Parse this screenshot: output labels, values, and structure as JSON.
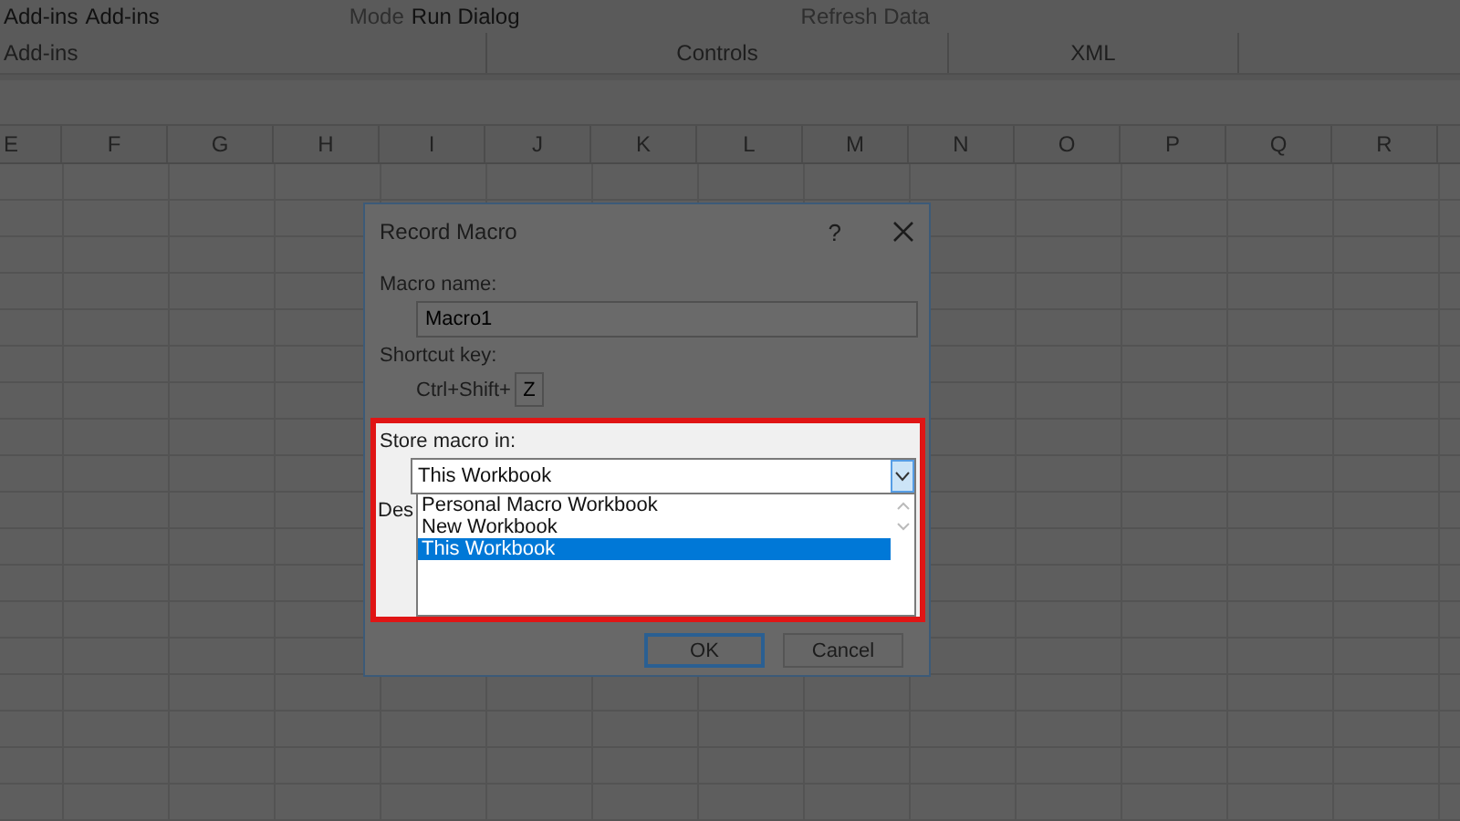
{
  "ribbon": {
    "top_items": [
      "Add-ins",
      "Add-ins",
      "Mode",
      "Run Dialog",
      "Refresh Data"
    ],
    "groups": [
      "Add-ins",
      "Controls",
      "XML"
    ]
  },
  "sheet": {
    "columns": [
      "E",
      "F",
      "G",
      "H",
      "I",
      "J",
      "K",
      "L",
      "M",
      "N",
      "O",
      "P",
      "Q",
      "R"
    ]
  },
  "dialog": {
    "title": "Record Macro",
    "help": "?",
    "macro_name": {
      "label": "Macro name:",
      "value": "Macro1"
    },
    "shortcut": {
      "label": "Shortcut key:",
      "prefix": "Ctrl+Shift+",
      "value": "Z"
    },
    "store": {
      "label": "Store macro in:",
      "value": "This Workbook",
      "expanded": true,
      "options": [
        {
          "label": "Personal Macro Workbook",
          "selected": false
        },
        {
          "label": "New Workbook",
          "selected": false
        },
        {
          "label": "This Workbook",
          "selected": true
        }
      ]
    },
    "description": {
      "label": "Des"
    },
    "buttons": [
      {
        "label": "OK",
        "kind": "default"
      },
      {
        "label": "Cancel",
        "kind": "normal"
      }
    ]
  }
}
